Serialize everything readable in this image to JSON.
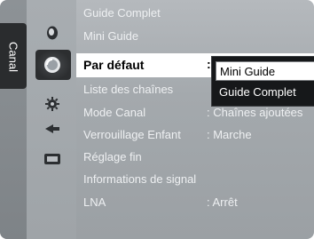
{
  "side_label": "Canal",
  "menu": {
    "items": [
      {
        "label": "Guide Complet",
        "value": ""
      },
      {
        "label": "Mini Guide",
        "value": ""
      },
      {
        "label": "Par défaut",
        "value": ":"
      },
      {
        "label": "Liste des chaînes",
        "value": ""
      },
      {
        "label": "Mode Canal",
        "value": ": Chaînes ajoutées"
      },
      {
        "label": "Verrouillage Enfant",
        "value": ": Marche"
      },
      {
        "label": "Réglage fin",
        "value": ""
      },
      {
        "label": "Informations de signal",
        "value": ""
      },
      {
        "label": "LNA",
        "value": ": Arrêt"
      }
    ]
  },
  "dropdown": {
    "options": [
      "Mini Guide",
      "Guide Complet"
    ],
    "selected": "Mini Guide"
  },
  "icons": [
    "picture-icon",
    "channel-icon",
    "setup-icon",
    "input-icon",
    "application-icon"
  ]
}
